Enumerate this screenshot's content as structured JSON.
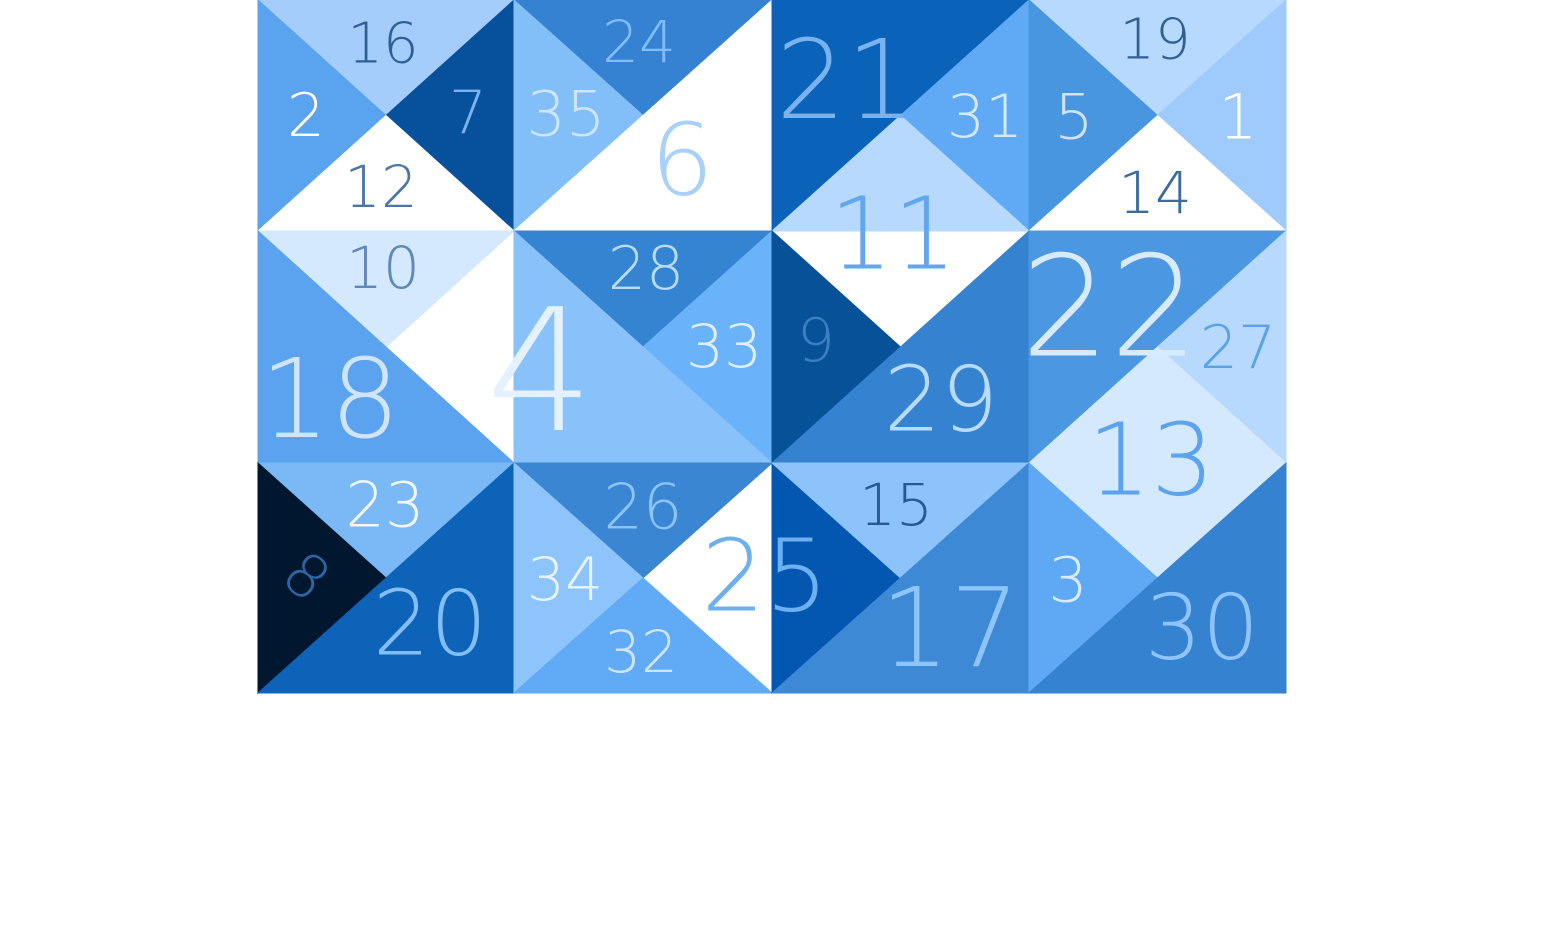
{
  "puzzle": {
    "pieces": [
      {
        "id": "r0c0-top",
        "number": "16",
        "fill": "#a5cdfb",
        "text_color": "#2e5f96"
      },
      {
        "id": "r0c0-left",
        "number": "2",
        "fill": "#5aa3ef",
        "text_color": "#ffffff"
      },
      {
        "id": "r0c0-right",
        "number": "7",
        "fill": "#07509b",
        "text_color": "#7ab3ee"
      },
      {
        "id": "r0c0-bottom",
        "number": "12",
        "fill": "#ffffff",
        "text_color": "#4c76a9"
      },
      {
        "id": "r0c1-top",
        "number": "24",
        "fill": "#3482d1",
        "text_color": "#81bcf9"
      },
      {
        "id": "r0c1-left",
        "number": "35",
        "fill": "#82bff9",
        "text_color": "#cfe5ff"
      },
      {
        "id": "r0c1-br",
        "number": "6",
        "fill": "#ffffff",
        "text_color": "#a9d0fb"
      },
      {
        "id": "r0c2-tl",
        "number": "21",
        "fill": "#0b63b9",
        "text_color": "#78b3ef"
      },
      {
        "id": "r0c2-right",
        "number": "31",
        "fill": "#60aaf5",
        "text_color": "#d4e9ff"
      },
      {
        "id": "r0c2-bottom",
        "number": "11",
        "fill": "#b6d9fd",
        "text_color": "#61a6ee"
      },
      {
        "id": "r0c3-top",
        "number": "19",
        "fill": "#b6d9fd",
        "text_color": "#2f5f94"
      },
      {
        "id": "r0c3-left",
        "number": "5",
        "fill": "#4895e0",
        "text_color": "#cfe4fb"
      },
      {
        "id": "r0c3-right",
        "number": "1",
        "fill": "#9fcbfc",
        "text_color": "#ffffff"
      },
      {
        "id": "r0c3-bottom",
        "number": "14",
        "fill": "#ffffff",
        "text_color": "#3d6b9e"
      },
      {
        "id": "r1c0-top",
        "number": "10",
        "fill": "#d4e8fe",
        "text_color": "#5d88b9"
      },
      {
        "id": "r1c0-bl",
        "number": "18",
        "fill": "#5ba3ef",
        "text_color": "#cfe5ff"
      },
      {
        "id": "r1c1-top",
        "number": "28",
        "fill": "#3584d2",
        "text_color": "#b7dafd"
      },
      {
        "id": "r1c1-right",
        "number": "33",
        "fill": "#6ab3fb",
        "text_color": "#e0efff"
      },
      {
        "id": "r1c1-left",
        "number": "4",
        "fill": "#89c2fb",
        "text_color": "#e4f1ff"
      },
      {
        "id": "r1c2-left",
        "number": "9",
        "fill": "#075198",
        "text_color": "#3d7dc1"
      },
      {
        "id": "r1c2-br",
        "number": "29",
        "fill": "#3582d0",
        "text_color": "#b8dafc"
      },
      {
        "id": "r1c3-tl",
        "number": "22",
        "fill": "#4b97e2",
        "text_color": "#d8eafd"
      },
      {
        "id": "r1c3-right",
        "number": "27",
        "fill": "#b6d9fd",
        "text_color": "#5aa1ea"
      },
      {
        "id": "r1c3-bottom",
        "number": "13",
        "fill": "#d5e9fe",
        "text_color": "#5ba3ee"
      },
      {
        "id": "r2c0-top",
        "number": "23",
        "fill": "#7ab9f6",
        "text_color": "#f0f7ff"
      },
      {
        "id": "r2c0-left",
        "number": "8",
        "fill": "#00172f",
        "text_color": "#2e66a4"
      },
      {
        "id": "r2c0-br",
        "number": "20",
        "fill": "#0d63b8",
        "text_color": "#82bdf8"
      },
      {
        "id": "r2c1-top",
        "number": "26",
        "fill": "#3a86d2",
        "text_color": "#8cc3f8"
      },
      {
        "id": "r2c1-left",
        "number": "34",
        "fill": "#8dc4fb",
        "text_color": "#e7f3ff"
      },
      {
        "id": "r2c1-bottom",
        "number": "32",
        "fill": "#61aaf5",
        "text_color": "#cfe5ff"
      },
      {
        "id": "r2c2-left",
        "number": "25",
        "fill": "#0357b1",
        "text_color": "#6db0f2"
      },
      {
        "id": "r2c2-top",
        "number": "15",
        "fill": "#8cc3fb",
        "text_color": "#27588f"
      },
      {
        "id": "r2c2-br",
        "number": "17",
        "fill": "#3e89d6",
        "text_color": "#8cc4fb"
      },
      {
        "id": "r2c3-top",
        "number": "13-ext",
        "fill": "#d5e9fe",
        "text_color": "#5ba3ee"
      },
      {
        "id": "r2c3-left",
        "number": "3",
        "fill": "#5ea8f4",
        "text_color": "#d8ebff"
      },
      {
        "id": "r2c3-br",
        "number": "30",
        "fill": "#3582d0",
        "text_color": "#8ec4fb"
      }
    ]
  }
}
